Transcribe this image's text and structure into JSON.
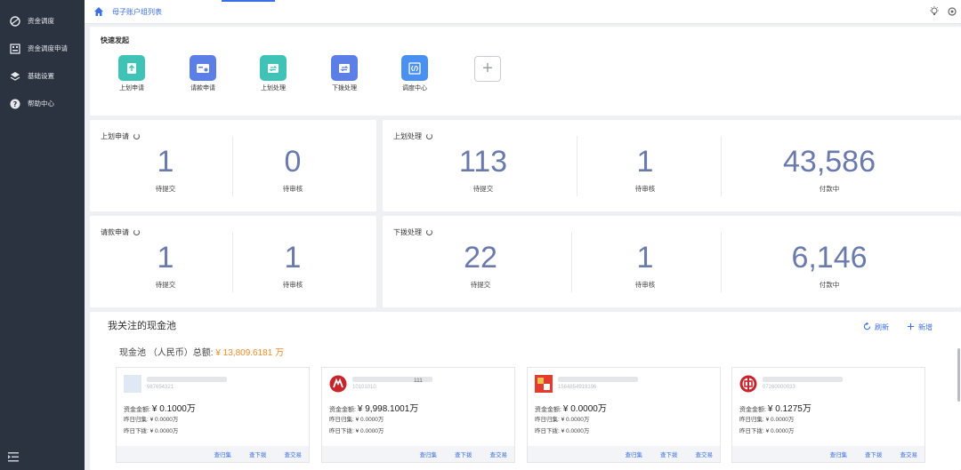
{
  "sidebar": {
    "items": [
      {
        "label": "资金调度",
        "icon": "globe-icon"
      },
      {
        "label": "资金调度申请",
        "icon": "grid-icon"
      },
      {
        "label": "基础设置",
        "icon": "layers-icon"
      },
      {
        "label": "帮助中心",
        "icon": "help-icon"
      }
    ]
  },
  "header": {
    "breadcrumb": "母子账户组列表"
  },
  "quick": {
    "title": "快速发起",
    "items": [
      {
        "label": "上划申请",
        "color": "#3fc3b6"
      },
      {
        "label": "请款申请",
        "color": "#5b7fe6"
      },
      {
        "label": "上划处理",
        "color": "#3fc3b6"
      },
      {
        "label": "下拨处理",
        "color": "#5b7fe6"
      },
      {
        "label": "调度中心",
        "color": "#4a90f0"
      }
    ],
    "add_label": "+"
  },
  "stats": {
    "up_apply": {
      "title": "上划申请",
      "cells": [
        {
          "value": "1",
          "label": "待提交"
        },
        {
          "value": "0",
          "label": "待审核"
        }
      ]
    },
    "up_handle": {
      "title": "上划处理",
      "cells": [
        {
          "value": "113",
          "label": "待提交"
        },
        {
          "value": "1",
          "label": "待审核"
        },
        {
          "value": "43,586",
          "label": "付款中"
        }
      ]
    },
    "req_apply": {
      "title": "请款申请",
      "cells": [
        {
          "value": "1",
          "label": "待提交"
        },
        {
          "value": "1",
          "label": "待审核"
        }
      ]
    },
    "down_handle": {
      "title": "下拨处理",
      "cells": [
        {
          "value": "22",
          "label": "待提交"
        },
        {
          "value": "1",
          "label": "待审核"
        },
        {
          "value": "6,146",
          "label": "付款中"
        }
      ]
    }
  },
  "pool": {
    "title": "我关注的现金池",
    "refresh": "刷新",
    "add": "新增",
    "total_label": "现金池 （人民币）总额:",
    "total_amount": "¥ 13,809.6181 万",
    "accounts": [
      {
        "number": "987654321",
        "extra": "",
        "balance_label": "资金金额:",
        "balance": "¥ 0.1000万",
        "y_up_label": "昨日归集:",
        "y_up": "¥ 0.0000万",
        "y_down_label": "昨日下拨:",
        "y_down": "¥ 0.0000万",
        "links": [
          "查归集",
          "查下拨",
          "查交易"
        ]
      },
      {
        "number": "10101010",
        "extra": "111",
        "balance_label": "资金金额:",
        "balance": "¥ 9,998.1001万",
        "y_up_label": "昨日归集:",
        "y_up": "¥ 0.0000万",
        "y_down_label": "昨日下拨:",
        "y_down": "¥ 0.0000万",
        "links": [
          "查归集",
          "查下拨",
          "查交易"
        ]
      },
      {
        "number": "1564854919196",
        "extra": "",
        "balance_label": "资金金额:",
        "balance": "¥ 0.0000万",
        "y_up_label": "昨日归集:",
        "y_up": "¥ 0.0000万",
        "y_down_label": "昨日下拨:",
        "y_down": "¥ 0.0000万",
        "links": [
          "查归集",
          "查下拨",
          "查交易"
        ]
      },
      {
        "number": "07260000033",
        "extra": "",
        "balance_label": "资金金额:",
        "balance": "¥ 0.1275万",
        "y_up_label": "昨日归集:",
        "y_up": "¥ 0.0000万",
        "y_down_label": "昨日下拨:",
        "y_down": "¥ 0.0000万",
        "links": [
          "查归集",
          "查下拨",
          "查交易"
        ]
      }
    ]
  },
  "colors": {
    "accent": "#3a6fe5",
    "number": "#6a7aad",
    "amount": "#f08a2a",
    "sidebar": "#2b3340"
  }
}
